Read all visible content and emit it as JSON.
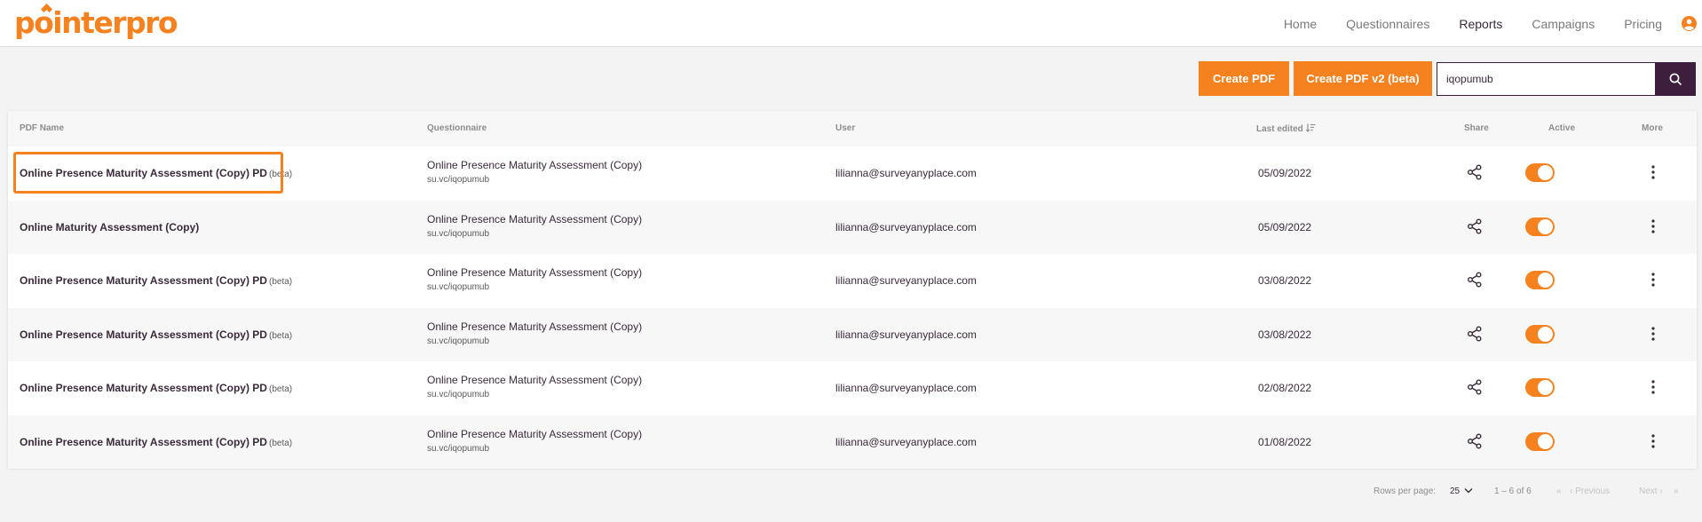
{
  "brand": {
    "logo_text": "pointerpro",
    "accent": "#f5821f",
    "dark": "#3d1f3d"
  },
  "nav": {
    "items": [
      {
        "label": "Home"
      },
      {
        "label": "Questionnaires"
      },
      {
        "label": "Reports",
        "active": true
      },
      {
        "label": "Campaigns"
      },
      {
        "label": "Pricing"
      }
    ],
    "user_icon": "user-circle-icon"
  },
  "toolbar": {
    "create_pdf": "Create PDF",
    "create_pdf_v2": "Create PDF v2 (beta)",
    "search_value": "iqopumub",
    "search_icon": "search-icon"
  },
  "table": {
    "headers": {
      "pdf_name": "PDF Name",
      "questionnaire": "Questionnaire",
      "user": "User",
      "last_edited": "Last edited",
      "share": "Share",
      "active": "Active",
      "more": "More"
    },
    "rows": [
      {
        "name": "Online Presence Maturity Assessment (Copy) PD",
        "badge": "(beta)",
        "questionnaire": "Online Presence Maturity Assessment (Copy)",
        "link": "su.vc/iqopumub",
        "user": "lilianna@surveyanyplace.com",
        "date": "05/09/2022",
        "active": true
      },
      {
        "name": "Online Maturity Assessment (Copy)",
        "badge": "",
        "questionnaire": "Online Presence Maturity Assessment (Copy)",
        "link": "su.vc/iqopumub",
        "user": "lilianna@surveyanyplace.com",
        "date": "05/09/2022",
        "active": true
      },
      {
        "name": "Online Presence Maturity Assessment (Copy) PD",
        "badge": "(beta)",
        "questionnaire": "Online Presence Maturity Assessment (Copy)",
        "link": "su.vc/iqopumub",
        "user": "lilianna@surveyanyplace.com",
        "date": "03/08/2022",
        "active": true
      },
      {
        "name": "Online Presence Maturity Assessment (Copy) PD",
        "badge": "(beta)",
        "questionnaire": "Online Presence Maturity Assessment (Copy)",
        "link": "su.vc/iqopumub",
        "user": "lilianna@surveyanyplace.com",
        "date": "03/08/2022",
        "active": true
      },
      {
        "name": "Online Presence Maturity Assessment (Copy) PD",
        "badge": "(beta)",
        "questionnaire": "Online Presence Maturity Assessment (Copy)",
        "link": "su.vc/iqopumub",
        "user": "lilianna@surveyanyplace.com",
        "date": "02/08/2022",
        "active": true
      },
      {
        "name": "Online Presence Maturity Assessment (Copy) PD",
        "badge": "(beta)",
        "questionnaire": "Online Presence Maturity Assessment (Copy)",
        "link": "su.vc/iqopumub",
        "user": "lilianna@surveyanyplace.com",
        "date": "01/08/2022",
        "active": true
      }
    ]
  },
  "pagination": {
    "rows_per_page_label": "Rows per page:",
    "rows_per_page_value": "25",
    "range": "1 – 6 of 6",
    "previous": "Previous",
    "next": "Next"
  }
}
